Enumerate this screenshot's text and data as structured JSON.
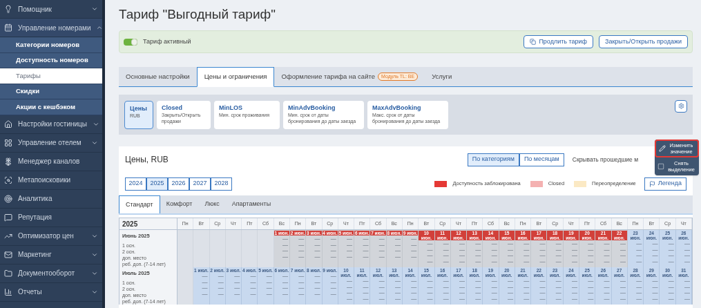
{
  "sidebar": {
    "items": [
      {
        "label": "Помощник",
        "expanded": false
      },
      {
        "label": "Управление номерами",
        "expanded": true,
        "children": [
          {
            "label": "Категории номеров",
            "selected": false
          },
          {
            "label": "Доступность номеров",
            "selected": false
          },
          {
            "label": "Тарифы",
            "selected": true
          },
          {
            "label": "Скидки",
            "selected": false
          },
          {
            "label": "Акции с кешбэком",
            "selected": false
          }
        ]
      },
      {
        "label": "Настройки гостиницы",
        "expanded": false
      },
      {
        "label": "Управление отелем",
        "expanded": false
      },
      {
        "label": "Менеджер каналов"
      },
      {
        "label": "Метапоисковики"
      },
      {
        "label": "Аналитика"
      },
      {
        "label": "Репутация"
      },
      {
        "label": "Оптимизатор цен",
        "expanded": false
      },
      {
        "label": "Маркетинг",
        "expanded": false
      },
      {
        "label": "Документооборот",
        "expanded": false
      },
      {
        "label": "Отчеты",
        "expanded": false
      }
    ]
  },
  "title": "Тариф \"Выгодный тариф\"",
  "status_banner": {
    "label": "Тариф активный",
    "on": true,
    "buttons": [
      {
        "label": "Продлить тариф"
      },
      {
        "label": "Закрыть/Открыть продажи"
      }
    ]
  },
  "tabs": [
    {
      "label": "Основные настройки",
      "selected": false
    },
    {
      "label": "Цены и ограничения",
      "selected": true
    },
    {
      "label": "Оформление тарифа на сайте",
      "badge": "Модуль TL: BE",
      "selected": false
    },
    {
      "label": "Услуги",
      "selected": false
    }
  ],
  "restriction_types": [
    {
      "title": "Цены",
      "subtitle": "RUB",
      "selected": true
    },
    {
      "title": "Closed",
      "subtitle": "Закрыть/Открыть продажи",
      "selected": false
    },
    {
      "title": "MinLOS",
      "subtitle": "Мин. срок проживания",
      "selected": false
    },
    {
      "title": "MinAdvBooking",
      "subtitle": "Мин. срок от даты бронирования до даты заезда",
      "selected": false
    },
    {
      "title": "MaxAdvBooking",
      "subtitle": "Макс. срок от даты бронирования до даты заезда",
      "selected": false
    }
  ],
  "prices": {
    "title": "Цены, RUB",
    "view_toggle": [
      {
        "label": "По категориям",
        "selected": true
      },
      {
        "label": "По месяцам",
        "selected": false
      }
    ],
    "hide_past_label": "Скрывать прошедшие м",
    "years": [
      {
        "label": "2024",
        "selected": false
      },
      {
        "label": "2025",
        "selected": true
      },
      {
        "label": "2026",
        "selected": false
      },
      {
        "label": "2027",
        "selected": false
      },
      {
        "label": "2028",
        "selected": false
      }
    ],
    "legend": [
      {
        "label": "Доступность заблокирована",
        "color": "#e53935"
      },
      {
        "label": "Closed",
        "color": "#f4b1b1"
      },
      {
        "label": "Переопределение",
        "color": "#fbe9c4"
      }
    ],
    "legend_button": "Легенда",
    "room_tabs": [
      {
        "label": "Стандарт",
        "selected": true
      },
      {
        "label": "Комфорт",
        "selected": false
      },
      {
        "label": "Люкс",
        "selected": false
      },
      {
        "label": "Апартаменты",
        "selected": false
      }
    ],
    "calendar": {
      "year": "2025",
      "weekdays": [
        "Пн",
        "Вт",
        "Ср",
        "Чт",
        "Пт",
        "Сб",
        "Вс",
        "Пн",
        "Вт",
        "Ср",
        "Чт",
        "Пт",
        "Сб",
        "Вс",
        "Пн",
        "Вт",
        "Ср",
        "Чт",
        "Пт",
        "Сб",
        "Вс",
        "Пн",
        "Вт",
        "Ср",
        "Чт",
        "Пт",
        "Сб",
        "Вс",
        "Пн",
        "Вт",
        "Ср",
        "Чт"
      ],
      "months": [
        {
          "label": "Июнь 2025",
          "rows": [
            "1 осн.",
            "2 осн.",
            "доп. место",
            "реб. доп. (7-14 лет)"
          ],
          "days": [
            {
              "label": "1 июн.",
              "blocked": true,
              "selected": false,
              "values": [
                "—",
                "—",
                "—",
                "—"
              ]
            },
            {
              "label": "2 июн.",
              "blocked": true,
              "selected": false,
              "values": [
                "—",
                "—",
                "—",
                "—"
              ]
            },
            {
              "label": "3 июн.",
              "blocked": true,
              "selected": false,
              "values": [
                "—",
                "—",
                "—",
                "—"
              ]
            },
            {
              "label": "4 июн.",
              "blocked": true,
              "selected": false,
              "values": [
                "—",
                "—",
                "—",
                "—"
              ]
            },
            {
              "label": "5 июн.",
              "blocked": true,
              "selected": false,
              "values": [
                "—",
                "—",
                "—",
                "—"
              ]
            },
            {
              "label": "6 июн.",
              "blocked": true,
              "selected": false,
              "values": [
                "—",
                "—",
                "—",
                "—"
              ]
            },
            {
              "label": "7 июн.",
              "blocked": true,
              "selected": false,
              "values": [
                "—",
                "—",
                "—",
                "—"
              ]
            },
            {
              "label": "8 июн.",
              "blocked": true,
              "selected": false,
              "values": [
                "—",
                "—",
                "—",
                "—"
              ]
            },
            {
              "label": "9 июн.",
              "blocked": true,
              "selected": false,
              "values": [
                "—",
                "—",
                "—",
                "—"
              ]
            },
            {
              "label": "10 июн.",
              "blocked": true,
              "selected": false,
              "values": [
                "—",
                "—",
                "—",
                "—"
              ]
            },
            {
              "label": "11 июн.",
              "blocked": true,
              "selected": false,
              "values": [
                "—",
                "—",
                "—",
                "—"
              ]
            },
            {
              "label": "12 июн.",
              "blocked": true,
              "selected": false,
              "values": [
                "—",
                "—",
                "—",
                "—"
              ]
            },
            {
              "label": "13 июн.",
              "blocked": true,
              "selected": false,
              "values": [
                "—",
                "—",
                "—",
                "—"
              ]
            },
            {
              "label": "14 июн.",
              "blocked": true,
              "selected": false,
              "values": [
                "—",
                "—",
                "—",
                "—"
              ]
            },
            {
              "label": "15 июн.",
              "blocked": true,
              "selected": false,
              "values": [
                "—",
                "—",
                "—",
                "—"
              ]
            },
            {
              "label": "16 июн.",
              "blocked": true,
              "selected": false,
              "values": [
                "—",
                "—",
                "—",
                "—"
              ]
            },
            {
              "label": "17 июн.",
              "blocked": true,
              "selected": false,
              "values": [
                "—",
                "—",
                "—",
                "—"
              ]
            },
            {
              "label": "18 июн.",
              "blocked": true,
              "selected": false,
              "values": [
                "—",
                "—",
                "—",
                "—"
              ]
            },
            {
              "label": "19 июн.",
              "blocked": true,
              "selected": false,
              "values": [
                "—",
                "—",
                "—",
                "—"
              ]
            },
            {
              "label": "20 июн.",
              "blocked": true,
              "selected": false,
              "values": [
                "—",
                "—",
                "—",
                "—"
              ]
            },
            {
              "label": "21 июн.",
              "blocked": true,
              "selected": false,
              "values": [
                "—",
                "—",
                "—",
                "—"
              ]
            },
            {
              "label": "22 июн.",
              "blocked": true,
              "selected": false,
              "values": [
                "—",
                "—",
                "—",
                "—"
              ]
            },
            {
              "label": "23 июн.",
              "blocked": false,
              "selected": true,
              "values": [
                "—",
                "—",
                "—",
                "—"
              ]
            },
            {
              "label": "24 июн.",
              "blocked": false,
              "selected": true,
              "values": [
                "—",
                "—",
                "—",
                "—"
              ]
            },
            {
              "label": "25 июн.",
              "blocked": false,
              "selected": true,
              "values": [
                "—",
                "—",
                "—",
                "—"
              ]
            },
            {
              "label": "26 июн.",
              "blocked": false,
              "selected": true,
              "values": [
                "—",
                "—",
                "—",
                "—"
              ]
            }
          ]
        },
        {
          "label": "Июль 2025",
          "rows": [
            "1 осн.",
            "2 осн.",
            "доп. место",
            "реб. доп. (7-14 лет)"
          ],
          "days": [
            {
              "label": "1 июл.",
              "blocked": false,
              "selected": true,
              "values": [
                "—",
                "—",
                "—",
                "—"
              ]
            },
            {
              "label": "2 июл.",
              "blocked": false,
              "selected": true,
              "values": [
                "—",
                "—",
                "—",
                "—"
              ]
            },
            {
              "label": "3 июл.",
              "blocked": false,
              "selected": true,
              "values": [
                "—",
                "—",
                "—",
                "—"
              ]
            },
            {
              "label": "4 июл.",
              "blocked": false,
              "selected": true,
              "values": [
                "—",
                "—",
                "—",
                "—"
              ]
            },
            {
              "label": "5 июл.",
              "blocked": false,
              "selected": true,
              "values": [
                "—",
                "—",
                "—",
                "—"
              ]
            },
            {
              "label": "6 июл.",
              "blocked": false,
              "selected": true,
              "values": [
                "—",
                "—",
                "—",
                "—"
              ]
            },
            {
              "label": "7 июл.",
              "blocked": false,
              "selected": true,
              "values": [
                "—",
                "—",
                "—",
                "—"
              ]
            },
            {
              "label": "8 июл.",
              "blocked": false,
              "selected": true,
              "values": [
                "—",
                "—",
                "—",
                "—"
              ]
            },
            {
              "label": "9 июл.",
              "blocked": false,
              "selected": true,
              "values": [
                "—",
                "—",
                "—",
                "—"
              ]
            },
            {
              "label": "10 июл.",
              "blocked": false,
              "selected": true,
              "values": [
                "—",
                "—",
                "—",
                "—"
              ]
            },
            {
              "label": "11 июл.",
              "blocked": false,
              "selected": true,
              "values": [
                "—",
                "—",
                "—",
                "—"
              ]
            },
            {
              "label": "12 июл.",
              "blocked": false,
              "selected": true,
              "values": [
                "—",
                "—",
                "—",
                "—"
              ]
            },
            {
              "label": "13 июл.",
              "blocked": false,
              "selected": true,
              "values": [
                "—",
                "—",
                "—",
                "—"
              ]
            },
            {
              "label": "14 июл.",
              "blocked": false,
              "selected": true,
              "values": [
                "—",
                "—",
                "—",
                "—"
              ]
            },
            {
              "label": "15 июл.",
              "blocked": false,
              "selected": true,
              "values": [
                "—",
                "—",
                "—",
                "—"
              ]
            },
            {
              "label": "16 июл.",
              "blocked": false,
              "selected": true,
              "values": [
                "—",
                "—",
                "—",
                "—"
              ]
            },
            {
              "label": "17 июл.",
              "blocked": false,
              "selected": true,
              "values": [
                "—",
                "—",
                "—",
                "—"
              ]
            },
            {
              "label": "18 июл.",
              "blocked": false,
              "selected": true,
              "values": [
                "—",
                "—",
                "—",
                "—"
              ]
            },
            {
              "label": "19 июл.",
              "blocked": false,
              "selected": true,
              "values": [
                "—",
                "—",
                "—",
                "—"
              ]
            },
            {
              "label": "20 июл.",
              "blocked": false,
              "selected": true,
              "values": [
                "—",
                "—",
                "—",
                "—"
              ]
            },
            {
              "label": "21 июл.",
              "blocked": false,
              "selected": true,
              "values": [
                "—",
                "—",
                "—",
                "—"
              ]
            },
            {
              "label": "22 июл.",
              "blocked": false,
              "selected": true,
              "values": [
                "—",
                "—",
                "—",
                "—"
              ]
            },
            {
              "label": "23 июл.",
              "blocked": false,
              "selected": true,
              "values": [
                "—",
                "—",
                "—",
                "—"
              ]
            },
            {
              "label": "24 июл.",
              "blocked": false,
              "selected": true,
              "values": [
                "—",
                "—",
                "—",
                "—"
              ]
            },
            {
              "label": "25 июл.",
              "blocked": false,
              "selected": true,
              "values": [
                "—",
                "—",
                "—",
                "—"
              ]
            },
            {
              "label": "26 июл.",
              "blocked": false,
              "selected": true,
              "values": [
                "—",
                "—",
                "—",
                "—"
              ]
            },
            {
              "label": "27 июл.",
              "blocked": false,
              "selected": true,
              "values": [
                "—",
                "—",
                "—",
                "—"
              ]
            },
            {
              "label": "28 июл.",
              "blocked": false,
              "selected": true,
              "values": [
                "—",
                "—",
                "—",
                "—"
              ]
            },
            {
              "label": "29 июл.",
              "blocked": false,
              "selected": true,
              "values": [
                "—",
                "—",
                "—",
                "—"
              ]
            },
            {
              "label": "30 июл.",
              "blocked": false,
              "selected": true,
              "values": [
                "—",
                "—",
                "—",
                "—"
              ]
            },
            {
              "label": "31 июл.",
              "blocked": false,
              "selected": true,
              "values": [
                "—",
                "—",
                "—",
                "—"
              ]
            }
          ]
        }
      ]
    }
  },
  "context_menu": [
    {
      "label": "Изменить значение",
      "highlighted": true
    },
    {
      "label": "Снять выделение",
      "highlighted": false
    }
  ]
}
